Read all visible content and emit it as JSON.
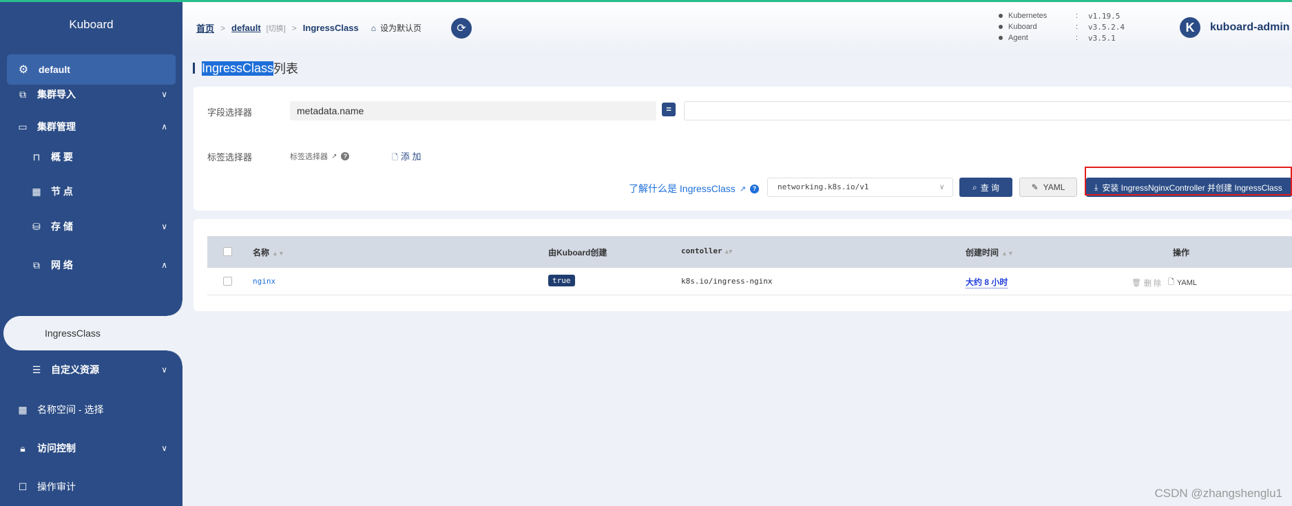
{
  "app": {
    "title": "Kuboard"
  },
  "cluster": {
    "name": "default"
  },
  "sidebar": {
    "items": [
      {
        "label": "集群导入",
        "icon": "import-icon",
        "chevron": "∨"
      },
      {
        "label": "集群管理",
        "icon": "cluster-icon",
        "chevron": "∧"
      },
      {
        "label": "概 要",
        "icon": "overview-icon"
      },
      {
        "label": "节 点",
        "icon": "nodes-icon"
      },
      {
        "label": "存 储",
        "icon": "storage-icon",
        "chevron": "∨"
      },
      {
        "label": "网 络",
        "icon": "network-icon",
        "chevron": "∧"
      },
      {
        "label": "IngressClass"
      },
      {
        "label": "自定义资源",
        "icon": "custom-resource-icon",
        "chevron": "∨"
      },
      {
        "label": "名称空间 - 选择",
        "icon": "grid-icon"
      },
      {
        "label": "访问控制",
        "icon": "lock-icon",
        "chevron": "∨"
      },
      {
        "label": "操作审计",
        "icon": "audit-icon"
      }
    ]
  },
  "breadcrumb": {
    "home": "首页",
    "cluster": "default",
    "switch": "[切换]",
    "current": "IngressClass",
    "set_default": "设为默认页"
  },
  "versions": [
    {
      "name": "Kubernetes",
      "value": "v1.19.5"
    },
    {
      "name": "Kuboard",
      "value": "v3.5.2.4"
    },
    {
      "name": "Agent",
      "value": "v3.5.1"
    }
  ],
  "user": {
    "avatar_letter": "K",
    "name": "kuboard-admin"
  },
  "page": {
    "title_highlight": "IngressClass",
    "title_rest": "列表"
  },
  "filter": {
    "field_selector_label": "字段选择器",
    "field_selector_value": "metadata.name",
    "eq": "=",
    "label_selector_label": "标签选择器",
    "label_selector_hint": "标签选择器",
    "add_label": "添 加",
    "learn_link": "了解什么是 IngressClass",
    "api_version": "networking.k8s.io/v1",
    "query_button": "查 询",
    "yaml_button": "YAML",
    "install_button": "安装 IngressNginxController 并创建 IngressClass"
  },
  "table": {
    "columns": [
      "名称",
      "由Kuboard创建",
      "contoller",
      "创建时间",
      "操作"
    ],
    "rows": [
      {
        "name": "nginx",
        "by_kuboard": "true",
        "controller": "k8s.io/ingress-nginx",
        "created": "大约 8 小时",
        "ops_delete": "删 除",
        "ops_yaml": "YAML"
      }
    ]
  },
  "watermark": "CSDN @zhangshenglu1",
  "colors": {
    "sidebar_bg": "#2b4c86",
    "accent": "#2b4c86",
    "link": "#1e6fd9",
    "highlight_box": "#e21d1d",
    "top_line": "#2bbd8e"
  }
}
